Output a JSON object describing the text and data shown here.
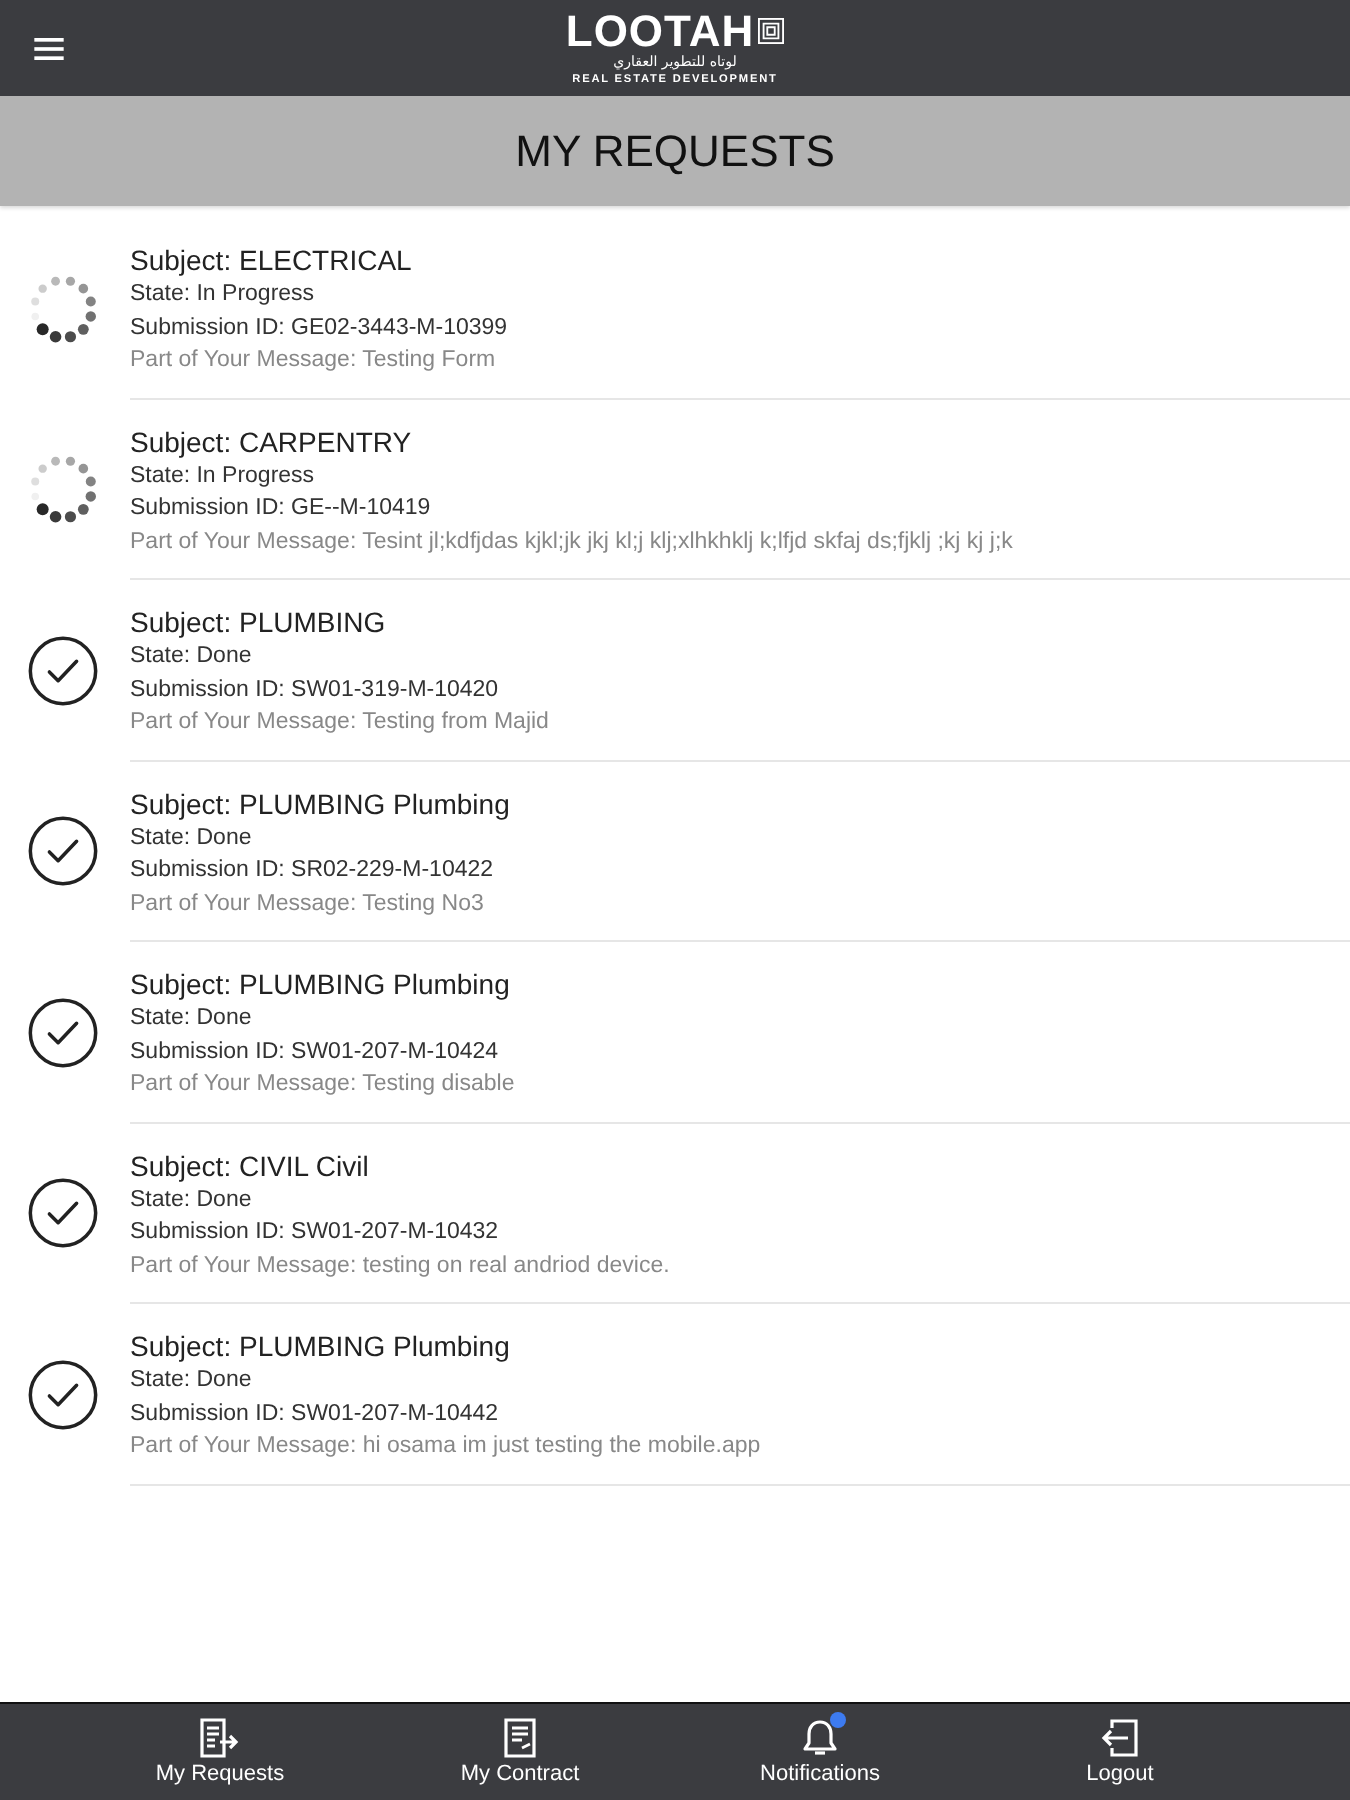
{
  "header": {
    "logo": {
      "name": "LOOTAH",
      "arabic": "لوتاه للتطوير العقاري",
      "tagline": "REAL ESTATE DEVELOPMENT"
    }
  },
  "title": "MY REQUESTS",
  "requests": [
    {
      "kind": "in_progress",
      "subject": "Subject: ELECTRICAL",
      "state": "State: In Progress",
      "submission_id": "Submission ID: GE02-3443-M-10399",
      "message": "Part of Your Message: Testing Form"
    },
    {
      "kind": "in_progress",
      "subject": "Subject: CARPENTRY",
      "state": "State: In Progress",
      "submission_id": "Submission ID: GE--M-10419",
      "message": "Part of Your Message: Tesint jl;kdfjdas kjkl;jk jkj kl;j klj;xlhkhklj k;lfjd skfaj ds;fjklj ;kj kj j;k"
    },
    {
      "kind": "done",
      "subject": "Subject: PLUMBING",
      "state": "State: Done",
      "submission_id": "Submission ID: SW01-319-M-10420",
      "message": "Part of Your Message: Testing from Majid"
    },
    {
      "kind": "done",
      "subject": "Subject: PLUMBING Plumbing",
      "state": "State: Done",
      "submission_id": "Submission ID: SR02-229-M-10422",
      "message": "Part of Your Message: Testing No3"
    },
    {
      "kind": "done",
      "subject": "Subject: PLUMBING Plumbing",
      "state": "State: Done",
      "submission_id": "Submission ID: SW01-207-M-10424",
      "message": "Part of Your Message: Testing disable"
    },
    {
      "kind": "done",
      "subject": "Subject: CIVIL Civil",
      "state": "State: Done",
      "submission_id": "Submission ID: SW01-207-M-10432",
      "message": "Part of Your Message: testing on real andriod device."
    },
    {
      "kind": "done",
      "subject": "Subject: PLUMBING Plumbing",
      "state": "State: Done",
      "submission_id": "Submission ID: SW01-207-M-10442",
      "message": "Part of Your Message: hi osama im just testing the mobile.app"
    }
  ],
  "bottom_nav": [
    {
      "kind": "requests",
      "label": "My Requests",
      "badge": false
    },
    {
      "kind": "contract",
      "label": "My Contract",
      "badge": false
    },
    {
      "kind": "notifications",
      "label": "Notifications",
      "badge": true
    },
    {
      "kind": "logout",
      "label": "Logout",
      "badge": false
    }
  ]
}
